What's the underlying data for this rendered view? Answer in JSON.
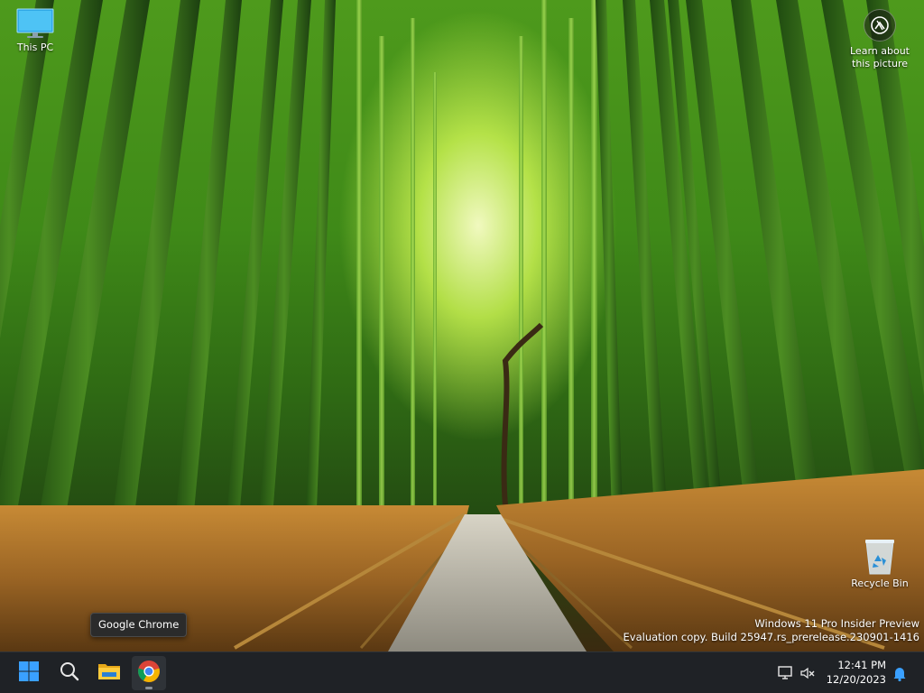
{
  "desktop": {
    "icons": [
      {
        "label": "This PC",
        "icon": "this-pc-icon"
      },
      {
        "label": "Recycle Bin",
        "icon": "recycle-bin-icon"
      }
    ],
    "learn_about": {
      "label_line1": "Learn about",
      "label_line2": "this picture",
      "icon": "camera-info-icon"
    },
    "watermark": {
      "line1": "Windows 11 Pro Insider Preview",
      "line2": "Evaluation copy. Build 25947.rs_prerelease.230901-1416"
    }
  },
  "tooltip": {
    "text": "Google Chrome"
  },
  "taskbar": {
    "buttons": [
      {
        "name": "Start",
        "icon": "windows-start-icon"
      },
      {
        "name": "Search",
        "icon": "search-icon"
      },
      {
        "name": "File Explorer",
        "icon": "folder-icon"
      },
      {
        "name": "Google Chrome",
        "icon": "chrome-icon",
        "active": true
      }
    ],
    "tray": {
      "network_icon": "network-icon",
      "volume_icon": "volume-muted-icon",
      "time": "12:41 PM",
      "date": "12/20/2023",
      "notification_icon": "bell-icon"
    }
  },
  "colors": {
    "taskbar_bg": "#1f2226",
    "accent_blue": "#3aa0ff",
    "bamboo_green": "#4e9a1c"
  }
}
